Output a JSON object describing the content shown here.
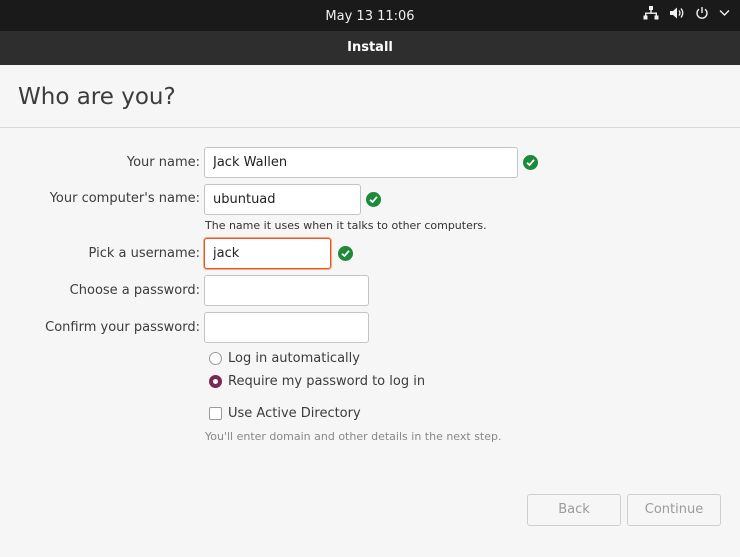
{
  "system_bar": {
    "clock": "May 13  11:06",
    "icons": [
      "network-icon",
      "volume-icon",
      "power-icon",
      "chevron-down-icon"
    ]
  },
  "window": {
    "title": "Install"
  },
  "page": {
    "heading": "Who are you?"
  },
  "form": {
    "name": {
      "label": "Your name:",
      "value": "Jack Wallen"
    },
    "computer_name": {
      "label": "Your computer's name:",
      "value": "ubuntuad",
      "hint": "The name it uses when it talks to other computers."
    },
    "username": {
      "label": "Pick a username:",
      "value": "jack"
    },
    "password": {
      "label": "Choose a password:",
      "value": ""
    },
    "confirm_password": {
      "label": "Confirm your password:",
      "value": ""
    },
    "login_options": [
      {
        "label": "Log in automatically",
        "selected": false
      },
      {
        "label": "Require my password to log in",
        "selected": true
      }
    ],
    "active_directory": {
      "label": "Use Active Directory",
      "checked": false,
      "hint": "You'll enter domain and other details in the next step."
    }
  },
  "buttons": {
    "back": "Back",
    "continue": "Continue"
  },
  "colors": {
    "valid_check": "#1c8a3a",
    "focus_border": "#e95420",
    "radio_selected": "#772953"
  }
}
